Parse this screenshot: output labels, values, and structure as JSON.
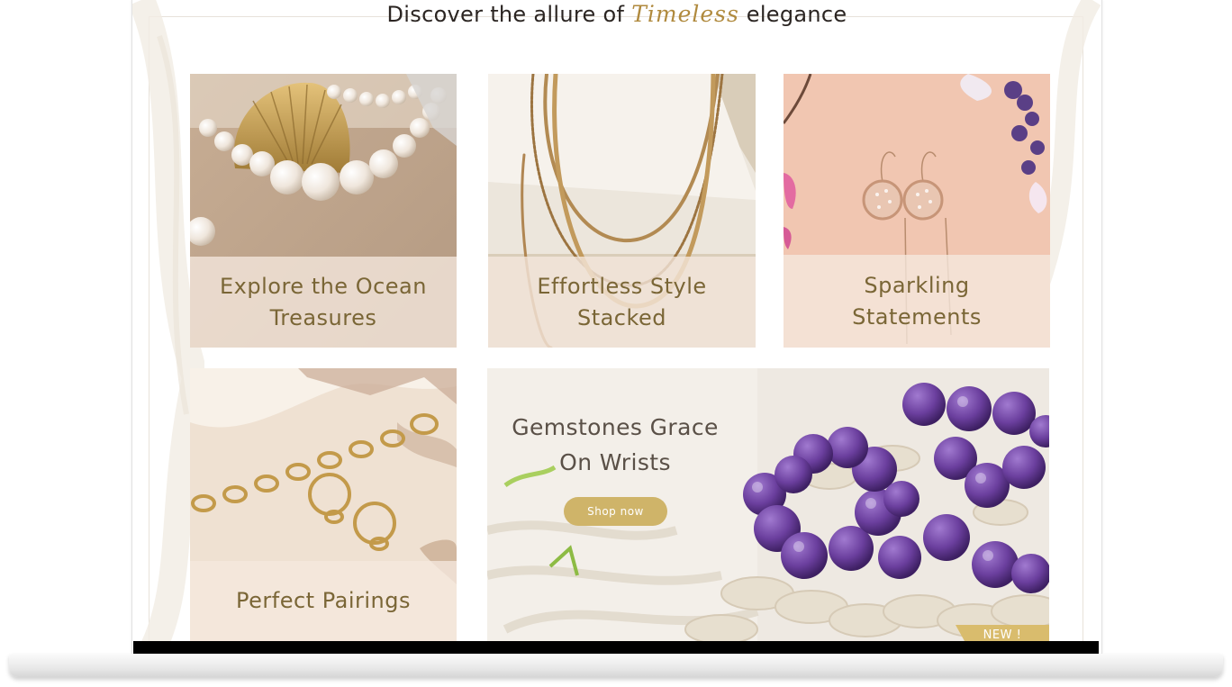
{
  "heading": {
    "prefix": "Discover the allure of",
    "script_word": "Timeless",
    "suffix": "elegance"
  },
  "tiles": [
    {
      "caption": "Explore the Ocean Treasures",
      "image": "pearls-and-gold-shell"
    },
    {
      "caption": "Effortless Style Stacked",
      "image": "layered-gold-necklaces"
    },
    {
      "caption": "Sparkling Statements",
      "image": "rose-gold-drop-earrings"
    },
    {
      "caption": "Perfect Pairings",
      "image": "gold-chain-and-hoop-earrings"
    }
  ],
  "hero": {
    "title": "Gemstones Grace On Wrists",
    "cta_label": "Shop now",
    "badge": "NEW !",
    "image": "amethyst-bead-bracelets"
  },
  "colors": {
    "accent_gold": "#cfb469",
    "caption_text": "#7a6636",
    "script_gold": "#b08a3e",
    "amethyst": "#6b3f9e"
  }
}
